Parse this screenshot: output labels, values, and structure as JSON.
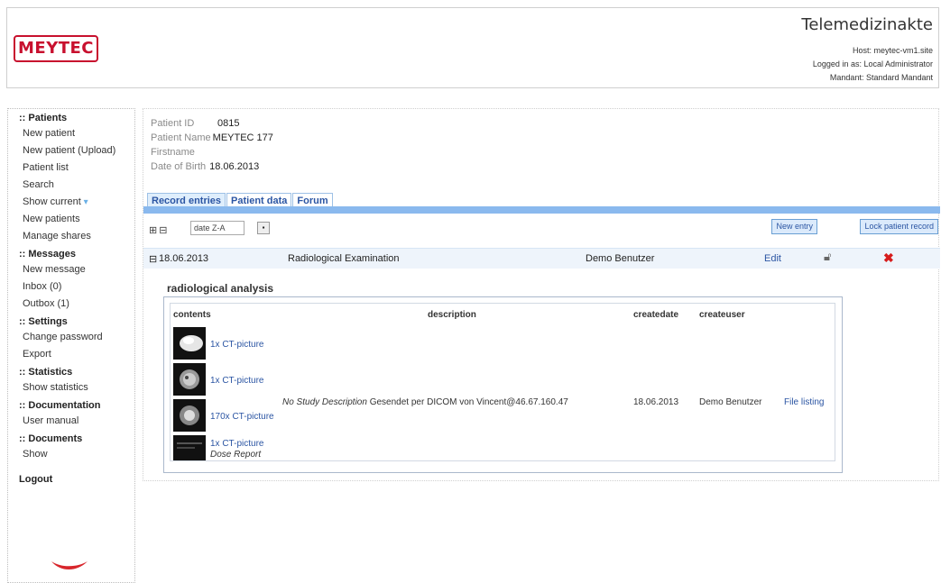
{
  "header": {
    "logo": "MEYTEC",
    "app_title": "Telemedizinakte",
    "host": "Host: meytec-vm1.site",
    "logged_in": "Logged in as: Local Administrator",
    "mandant": "Mandant: Standard Mandant"
  },
  "sidebar": {
    "groups": [
      {
        "title": ":: Patients",
        "items": [
          "New patient",
          "New patient (Upload)",
          "Patient list",
          "Search",
          "Show current",
          "New patients",
          "Manage shares"
        ]
      },
      {
        "title": ":: Messages",
        "items": [
          "New message",
          "Inbox (0)",
          "Outbox (1)"
        ]
      },
      {
        "title": ":: Settings",
        "items": [
          "Change password",
          "Export"
        ]
      },
      {
        "title": ":: Statistics",
        "items": [
          "Show statistics"
        ]
      },
      {
        "title": ":: Documentation",
        "items": [
          "User manual"
        ]
      },
      {
        "title": ":: Documents",
        "items": [
          "Show"
        ]
      }
    ],
    "logout": "Logout"
  },
  "patient": {
    "id_label": "Patient ID",
    "id": "0815",
    "name_label": "Patient Name",
    "name": "MEYTEC 177",
    "firstname_label": "Firstname",
    "firstname": "",
    "dob_label": "Date of Birth",
    "dob": "18.06.2013"
  },
  "tabs": [
    "Record entries",
    "Patient data",
    "Forum"
  ],
  "toolbar": {
    "sort_value": "date Z-A",
    "new_entry": "New entry",
    "lock_record": "Lock patient record"
  },
  "entry": {
    "date": "18.06.2013",
    "type": "Radiological Examination",
    "user": "Demo Benutzer",
    "edit": "Edit"
  },
  "analysis": {
    "title": "radiological analysis",
    "headers": [
      "contents",
      "description",
      "createdate",
      "createuser"
    ],
    "items": [
      "1x CT-picture",
      "1x CT-picture",
      "170x CT-picture",
      "1x CT-picture"
    ],
    "dose_report": "Dose Report",
    "description_italic": "No Study Description",
    "description_text": "Gesendet per DICOM von Vincent@46.67.160.47",
    "createdate": "18.06.2013",
    "createuser": "Demo Benutzer",
    "file_listing": "File listing"
  }
}
